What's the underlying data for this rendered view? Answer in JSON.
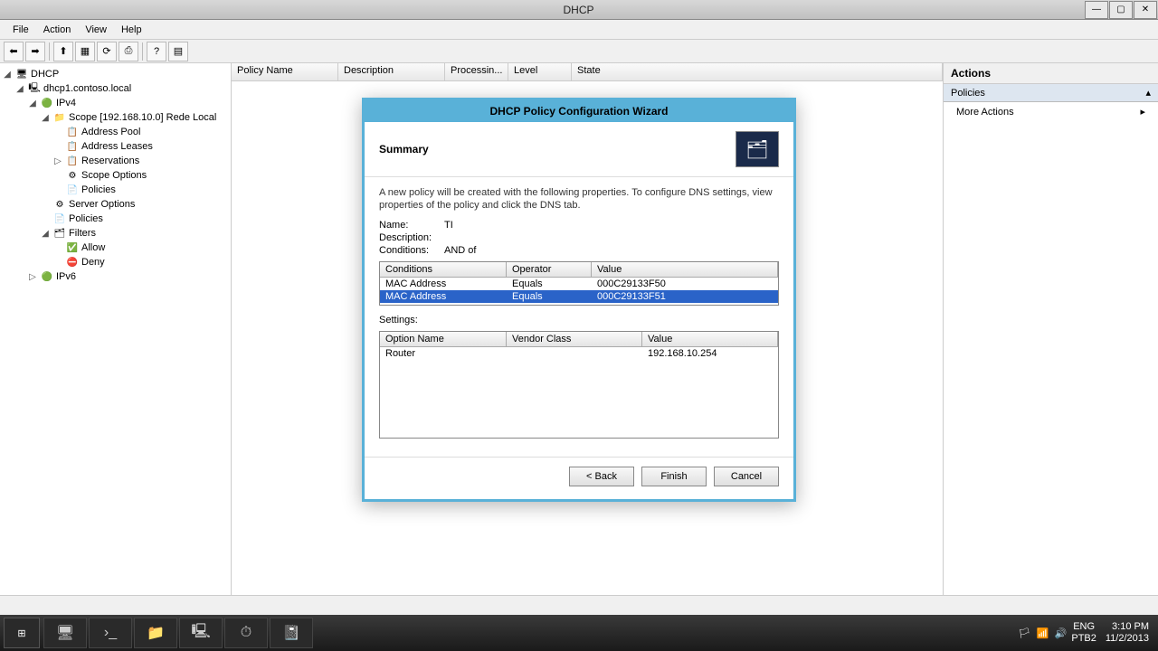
{
  "window": {
    "title": "DHCP"
  },
  "menu": {
    "file": "File",
    "action": "Action",
    "view": "View",
    "help": "Help"
  },
  "columns": {
    "policy": "Policy Name",
    "desc": "Description",
    "proc": "Processin...",
    "level": "Level",
    "state": "State"
  },
  "tree": {
    "root": "DHCP",
    "server": "dhcp1.contoso.local",
    "ipv4": "IPv4",
    "scope": "Scope [192.168.10.0] Rede Local",
    "addrpool": "Address Pool",
    "addrleases": "Address Leases",
    "reservations": "Reservations",
    "scopeopts": "Scope Options",
    "policies": "Policies",
    "serveropts": "Server Options",
    "policies2": "Policies",
    "filters": "Filters",
    "allow": "Allow",
    "deny": "Deny",
    "ipv6": "IPv6"
  },
  "actions": {
    "header": "Actions",
    "section": "Policies",
    "more": "More Actions"
  },
  "dialog": {
    "title": "DHCP Policy Configuration Wizard",
    "summary": "Summary",
    "info": "A new policy will be created with the following properties. To configure DNS settings, view properties of the policy and click the DNS tab.",
    "name_k": "Name:",
    "name_v": "TI",
    "desc_k": "Description:",
    "desc_v": "",
    "cond_k": "Conditions:",
    "cond_v": "AND of",
    "cond_hdr": {
      "c1": "Conditions",
      "c2": "Operator",
      "c3": "Value"
    },
    "cond_rows": [
      {
        "c1": "MAC Address",
        "c2": "Equals",
        "c3": "000C29133F50"
      },
      {
        "c1": "MAC Address",
        "c2": "Equals",
        "c3": "000C29133F51"
      }
    ],
    "settings_lbl": "Settings:",
    "set_hdr": {
      "c1": "Option Name",
      "c2": "Vendor Class",
      "c3": "Value"
    },
    "set_rows": [
      {
        "c1": "Router",
        "c2": "",
        "c3": "192.168.10.254"
      }
    ],
    "back": "< Back",
    "finish": "Finish",
    "cancel": "Cancel"
  },
  "taskbar": {
    "lang": "ENG",
    "kbd": "PTB2",
    "time": "3:10 PM",
    "date": "11/2/2013"
  }
}
